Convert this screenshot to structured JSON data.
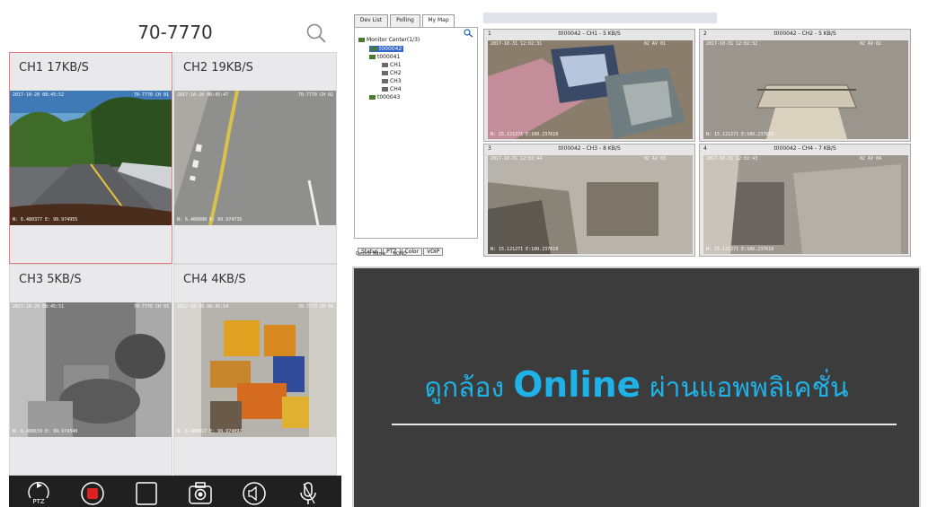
{
  "mobile": {
    "title": "70-7770",
    "channels": [
      {
        "label": "CH1 17KB/S",
        "osd_top": "2017-10-20 08:45:52",
        "osd_right": "70-7770 CH 01",
        "osd_bottom": "N: 6.480377 E: 99.974955"
      },
      {
        "label": "CH2 19KB/S",
        "osd_top": "2017-10-20 08:45:47",
        "osd_right": "70-7770 CH 02",
        "osd_bottom": "N: 6.480088 E: 99.974735"
      },
      {
        "label": "CH3 5KB/S",
        "osd_top": "2017-10-20 08:45:51",
        "osd_right": "70-7770 CH 03",
        "osd_bottom": "N: 6.480159 E: 99.974340"
      },
      {
        "label": "CH4 4KB/S",
        "osd_top": "2017-10-20 08:45:54",
        "osd_right": "70-7770 CH 04",
        "osd_bottom": "N: 6.480017 E: 99.974092"
      }
    ],
    "toolbar": {
      "ptz_label": "PTZ"
    }
  },
  "desktop": {
    "tabs": [
      "Dev List",
      "Polling",
      "My Map"
    ],
    "tree": {
      "root": "Monitor Center(1/3)",
      "devices": [
        "t000042",
        "t000041",
        "t000043"
      ],
      "channels": [
        "CH1",
        "CH2",
        "CH3",
        "CH4"
      ]
    },
    "bottom_tabs": [
      "Status",
      "PTZ",
      "Color",
      "VOIP"
    ],
    "device_name_label": "Device Name",
    "device_name_value": "NONO",
    "views": [
      {
        "num": "1",
        "title": "t000042 - CH1 - 5 KB/S",
        "osd_top": "2017-10-31 12:02:31",
        "osd_right": "02 AV 01",
        "osd_bottom": "N: 15.121271 E:100.237619"
      },
      {
        "num": "2",
        "title": "t000042 - CH2 - 5 KB/S",
        "osd_top": "2017-10-31 12:02:32",
        "osd_right": "02 AV 02",
        "osd_bottom": "N: 15.121271 E:100.237619"
      },
      {
        "num": "3",
        "title": "t000042 - CH3 - 8 KB/S",
        "osd_top": "2017-10-31 12:02:44",
        "osd_right": "02 AV 03",
        "osd_bottom": "N: 15.121271 E:100.237619"
      },
      {
        "num": "4",
        "title": "t000042 - CH4 - 7 KB/S",
        "osd_top": "2017-10-31 12:02:43",
        "osd_right": "02 AV 04",
        "osd_bottom": "N: 15.121271 E:100.237619"
      }
    ]
  },
  "banner": {
    "thai_before": "ดูกล้อง",
    "english": "Online",
    "thai_after": "ผ่านแอพพลิเคชั่น",
    "text_color": "#1fb2e8",
    "background": "#3c3c3c"
  }
}
